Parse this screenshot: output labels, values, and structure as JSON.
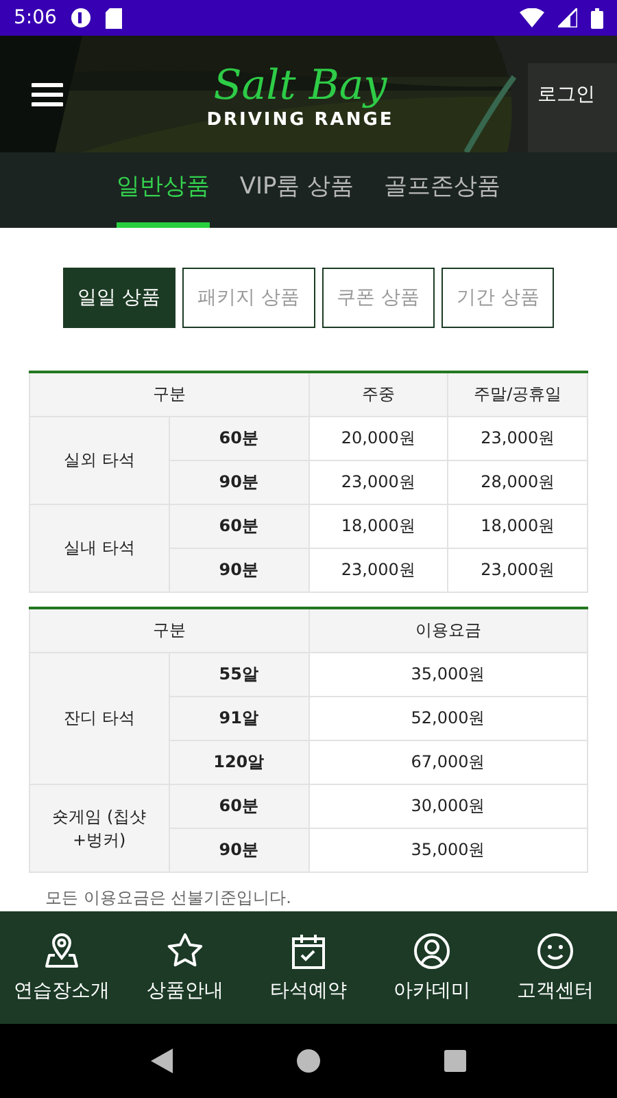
{
  "status_bar": {
    "time": "5:06"
  },
  "header": {
    "logo_title": "Salt Bay",
    "logo_subtitle": "DRIVING RANGE",
    "login": "로그인"
  },
  "tabs": [
    {
      "label": "일반상품",
      "selected": true
    },
    {
      "label": "VIP룸 상품",
      "selected": false
    },
    {
      "label": "골프존상품",
      "selected": false
    }
  ],
  "categories": [
    {
      "label": "일일 상품",
      "selected": true
    },
    {
      "label": "패키지 상품",
      "selected": false
    },
    {
      "label": "쿠폰 상품",
      "selected": false
    },
    {
      "label": "기간 상품",
      "selected": false
    }
  ],
  "tables": [
    {
      "columns": [
        "구분",
        "주중",
        "주말/공휴일"
      ],
      "groups": [
        {
          "name": "실외 타석",
          "rows": [
            {
              "option": "60분",
              "prices": [
                "20,000원",
                "23,000원"
              ]
            },
            {
              "option": "90분",
              "prices": [
                "23,000원",
                "28,000원"
              ]
            }
          ]
        },
        {
          "name": "실내 타석",
          "rows": [
            {
              "option": "60분",
              "prices": [
                "18,000원",
                "18,000원"
              ]
            },
            {
              "option": "90분",
              "prices": [
                "23,000원",
                "23,000원"
              ]
            }
          ]
        }
      ]
    },
    {
      "columns": [
        "구분",
        "이용요금"
      ],
      "groups": [
        {
          "name": "잔디 타석",
          "rows": [
            {
              "option": "55알",
              "prices": [
                "35,000원"
              ]
            },
            {
              "option": "91알",
              "prices": [
                "52,000원"
              ]
            },
            {
              "option": "120알",
              "prices": [
                "67,000원"
              ]
            }
          ]
        },
        {
          "name": "숏게임 (칩샷+벙커)",
          "rows": [
            {
              "option": "60분",
              "prices": [
                "30,000원"
              ]
            },
            {
              "option": "90분",
              "prices": [
                "35,000원"
              ]
            }
          ]
        }
      ]
    }
  ],
  "note": "모든 이용요금은 선불기준입니다.",
  "bottom_nav": [
    {
      "label": "연습장소개"
    },
    {
      "label": "상품안내"
    },
    {
      "label": "타석예약"
    },
    {
      "label": "아카데미"
    },
    {
      "label": "고객센터"
    }
  ]
}
